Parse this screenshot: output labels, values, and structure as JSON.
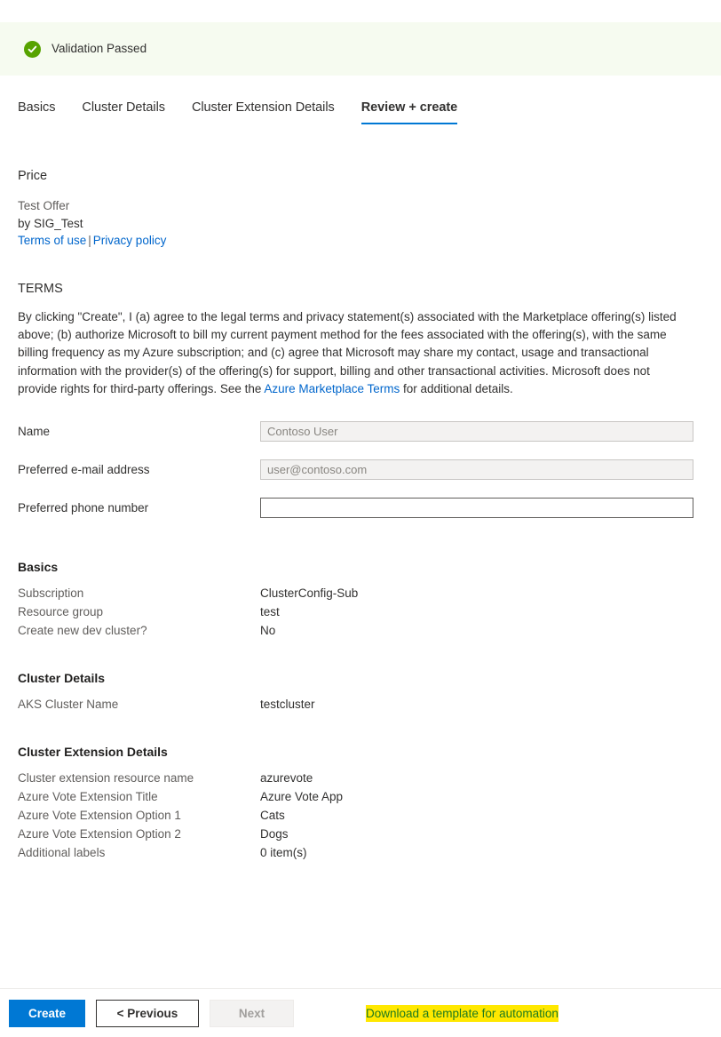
{
  "banner": {
    "icon": "check-circle-icon",
    "text": "Validation Passed",
    "bg_color": "#f6fbf0",
    "icon_color": "#57a300"
  },
  "tabs": [
    {
      "label": "Basics",
      "active": false
    },
    {
      "label": "Cluster Details",
      "active": false
    },
    {
      "label": "Cluster Extension Details",
      "active": false
    },
    {
      "label": "Review + create",
      "active": true
    }
  ],
  "price": {
    "heading": "Price",
    "offer_name": "Test Offer",
    "publisher": "by SIG_Test",
    "terms_of_use_link": "Terms of use",
    "separator": "|",
    "privacy_policy_link": "Privacy policy"
  },
  "terms": {
    "heading": "TERMS",
    "body_part_1": "By clicking \"Create\", I (a) agree to the legal terms and privacy statement(s) associated with the Marketplace offering(s) listed above; (b) authorize Microsoft to bill my current payment method for the fees associated with the offering(s), with the same billing frequency as my Azure subscription; and (c) agree that Microsoft may share my contact, usage and transactional information with the provider(s) of the offering(s) for support, billing and other transactional activities. Microsoft does not provide rights for third-party offerings. See the ",
    "marketplace_terms_link": "Azure Marketplace Terms",
    "body_part_2": " for additional details."
  },
  "form": {
    "name": {
      "label": "Name",
      "value": "Contoso User",
      "disabled": true
    },
    "email": {
      "label": "Preferred e-mail address",
      "value": "user@contoso.com",
      "disabled": true
    },
    "phone": {
      "label": "Preferred phone number",
      "value": "",
      "placeholder": "",
      "disabled": false
    }
  },
  "summary_sections": [
    {
      "title": "Basics",
      "rows": [
        {
          "key": "Subscription",
          "value": "ClusterConfig-Sub"
        },
        {
          "key": "Resource group",
          "value": "test"
        },
        {
          "key": "Create new dev cluster?",
          "value": "No"
        }
      ]
    },
    {
      "title": "Cluster Details",
      "rows": [
        {
          "key": "AKS Cluster Name",
          "value": "testcluster"
        }
      ]
    },
    {
      "title": "Cluster Extension Details",
      "rows": [
        {
          "key": "Cluster extension resource name",
          "value": "azurevote"
        },
        {
          "key": "Azure Vote Extension Title",
          "value": "Azure Vote App"
        },
        {
          "key": "Azure Vote Extension Option 1",
          "value": "Cats"
        },
        {
          "key": "Azure Vote Extension Option 2",
          "value": "Dogs"
        },
        {
          "key": "Additional labels",
          "value": "0 item(s)"
        }
      ]
    }
  ],
  "footer": {
    "create_label": "Create",
    "previous_label": "< Previous",
    "next_label": "Next",
    "download_label": "Download a template for automation",
    "primary_color": "#0078d4",
    "highlight_color": "#ffe800"
  }
}
